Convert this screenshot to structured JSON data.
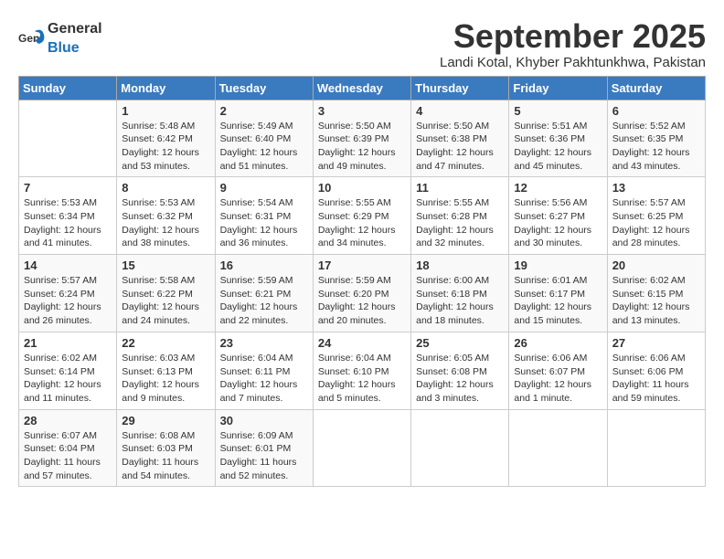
{
  "header": {
    "logo_general": "General",
    "logo_blue": "Blue",
    "month_title": "September 2025",
    "location": "Landi Kotal, Khyber Pakhtunkhwa, Pakistan"
  },
  "weekdays": [
    "Sunday",
    "Monday",
    "Tuesday",
    "Wednesday",
    "Thursday",
    "Friday",
    "Saturday"
  ],
  "weeks": [
    [
      {
        "day": "",
        "info": ""
      },
      {
        "day": "1",
        "info": "Sunrise: 5:48 AM\nSunset: 6:42 PM\nDaylight: 12 hours\nand 53 minutes."
      },
      {
        "day": "2",
        "info": "Sunrise: 5:49 AM\nSunset: 6:40 PM\nDaylight: 12 hours\nand 51 minutes."
      },
      {
        "day": "3",
        "info": "Sunrise: 5:50 AM\nSunset: 6:39 PM\nDaylight: 12 hours\nand 49 minutes."
      },
      {
        "day": "4",
        "info": "Sunrise: 5:50 AM\nSunset: 6:38 PM\nDaylight: 12 hours\nand 47 minutes."
      },
      {
        "day": "5",
        "info": "Sunrise: 5:51 AM\nSunset: 6:36 PM\nDaylight: 12 hours\nand 45 minutes."
      },
      {
        "day": "6",
        "info": "Sunrise: 5:52 AM\nSunset: 6:35 PM\nDaylight: 12 hours\nand 43 minutes."
      }
    ],
    [
      {
        "day": "7",
        "info": "Sunrise: 5:53 AM\nSunset: 6:34 PM\nDaylight: 12 hours\nand 41 minutes."
      },
      {
        "day": "8",
        "info": "Sunrise: 5:53 AM\nSunset: 6:32 PM\nDaylight: 12 hours\nand 38 minutes."
      },
      {
        "day": "9",
        "info": "Sunrise: 5:54 AM\nSunset: 6:31 PM\nDaylight: 12 hours\nand 36 minutes."
      },
      {
        "day": "10",
        "info": "Sunrise: 5:55 AM\nSunset: 6:29 PM\nDaylight: 12 hours\nand 34 minutes."
      },
      {
        "day": "11",
        "info": "Sunrise: 5:55 AM\nSunset: 6:28 PM\nDaylight: 12 hours\nand 32 minutes."
      },
      {
        "day": "12",
        "info": "Sunrise: 5:56 AM\nSunset: 6:27 PM\nDaylight: 12 hours\nand 30 minutes."
      },
      {
        "day": "13",
        "info": "Sunrise: 5:57 AM\nSunset: 6:25 PM\nDaylight: 12 hours\nand 28 minutes."
      }
    ],
    [
      {
        "day": "14",
        "info": "Sunrise: 5:57 AM\nSunset: 6:24 PM\nDaylight: 12 hours\nand 26 minutes."
      },
      {
        "day": "15",
        "info": "Sunrise: 5:58 AM\nSunset: 6:22 PM\nDaylight: 12 hours\nand 24 minutes."
      },
      {
        "day": "16",
        "info": "Sunrise: 5:59 AM\nSunset: 6:21 PM\nDaylight: 12 hours\nand 22 minutes."
      },
      {
        "day": "17",
        "info": "Sunrise: 5:59 AM\nSunset: 6:20 PM\nDaylight: 12 hours\nand 20 minutes."
      },
      {
        "day": "18",
        "info": "Sunrise: 6:00 AM\nSunset: 6:18 PM\nDaylight: 12 hours\nand 18 minutes."
      },
      {
        "day": "19",
        "info": "Sunrise: 6:01 AM\nSunset: 6:17 PM\nDaylight: 12 hours\nand 15 minutes."
      },
      {
        "day": "20",
        "info": "Sunrise: 6:02 AM\nSunset: 6:15 PM\nDaylight: 12 hours\nand 13 minutes."
      }
    ],
    [
      {
        "day": "21",
        "info": "Sunrise: 6:02 AM\nSunset: 6:14 PM\nDaylight: 12 hours\nand 11 minutes."
      },
      {
        "day": "22",
        "info": "Sunrise: 6:03 AM\nSunset: 6:13 PM\nDaylight: 12 hours\nand 9 minutes."
      },
      {
        "day": "23",
        "info": "Sunrise: 6:04 AM\nSunset: 6:11 PM\nDaylight: 12 hours\nand 7 minutes."
      },
      {
        "day": "24",
        "info": "Sunrise: 6:04 AM\nSunset: 6:10 PM\nDaylight: 12 hours\nand 5 minutes."
      },
      {
        "day": "25",
        "info": "Sunrise: 6:05 AM\nSunset: 6:08 PM\nDaylight: 12 hours\nand 3 minutes."
      },
      {
        "day": "26",
        "info": "Sunrise: 6:06 AM\nSunset: 6:07 PM\nDaylight: 12 hours\nand 1 minute."
      },
      {
        "day": "27",
        "info": "Sunrise: 6:06 AM\nSunset: 6:06 PM\nDaylight: 11 hours\nand 59 minutes."
      }
    ],
    [
      {
        "day": "28",
        "info": "Sunrise: 6:07 AM\nSunset: 6:04 PM\nDaylight: 11 hours\nand 57 minutes."
      },
      {
        "day": "29",
        "info": "Sunrise: 6:08 AM\nSunset: 6:03 PM\nDaylight: 11 hours\nand 54 minutes."
      },
      {
        "day": "30",
        "info": "Sunrise: 6:09 AM\nSunset: 6:01 PM\nDaylight: 11 hours\nand 52 minutes."
      },
      {
        "day": "",
        "info": ""
      },
      {
        "day": "",
        "info": ""
      },
      {
        "day": "",
        "info": ""
      },
      {
        "day": "",
        "info": ""
      }
    ]
  ]
}
